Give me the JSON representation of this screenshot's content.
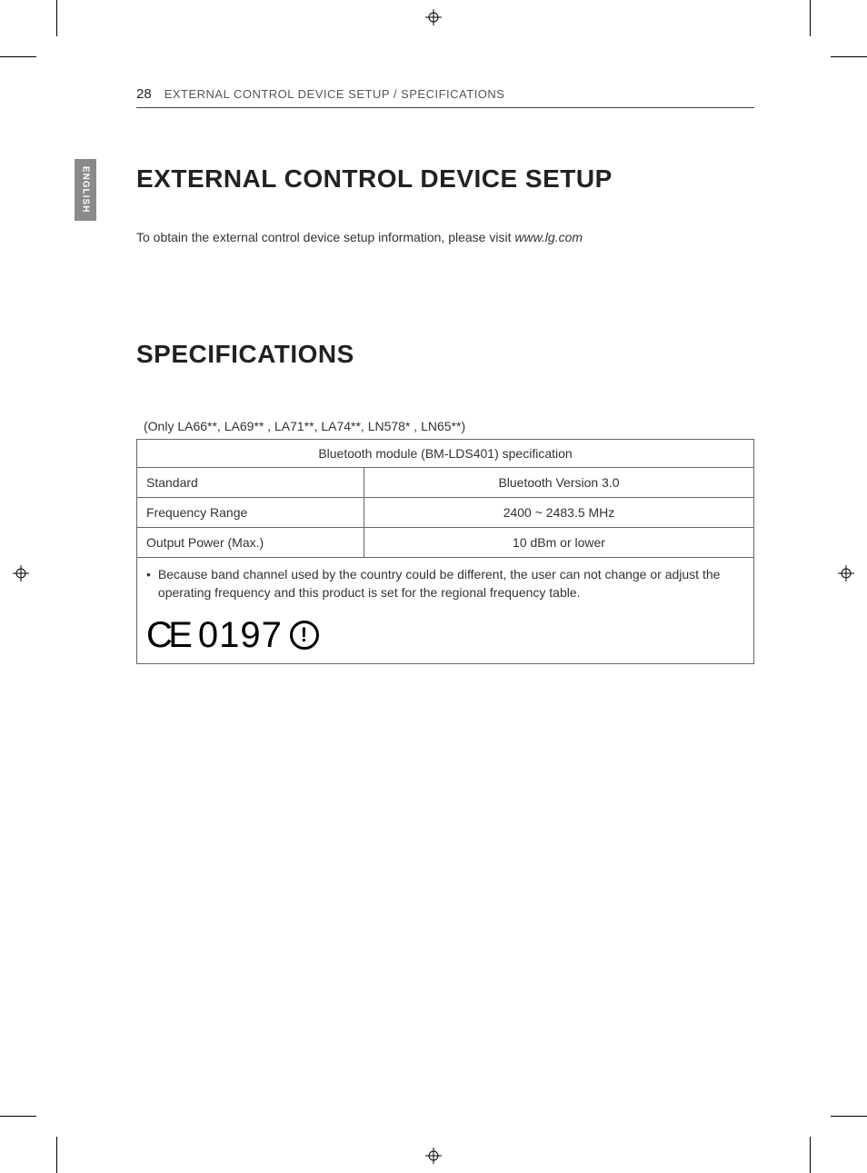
{
  "header": {
    "page_number": "28",
    "running_head": "EXTERNAL CONTROL DEVICE SETUP / SPECIFICATIONS"
  },
  "language_tab": "ENGLISH",
  "section1": {
    "title": "EXTERNAL CONTROL DEVICE SETUP",
    "intro_text": "To obtain the external control device setup information, please visit ",
    "intro_url": "www.lg.com"
  },
  "section2": {
    "title": "SPECIFICATIONS",
    "models_note": "(Only LA66**, LA69** , LA71**, LA74**, LN578* , LN65**)",
    "table": {
      "caption": "Bluetooth module (BM-LDS401) specification",
      "rows": [
        {
          "label": "Standard",
          "value": "Bluetooth Version 3.0"
        },
        {
          "label": "Frequency Range",
          "value": "2400 ~ 2483.5 MHz"
        },
        {
          "label": "Output Power (Max.)",
          "value": "10 dBm or lower"
        }
      ],
      "note": "Because band channel used by the country could be different, the user can not change or adjust the operating frequency and this product is set for the regional frequency table."
    },
    "ce": {
      "mark": "CE",
      "number": "0197",
      "alert": "!"
    }
  }
}
